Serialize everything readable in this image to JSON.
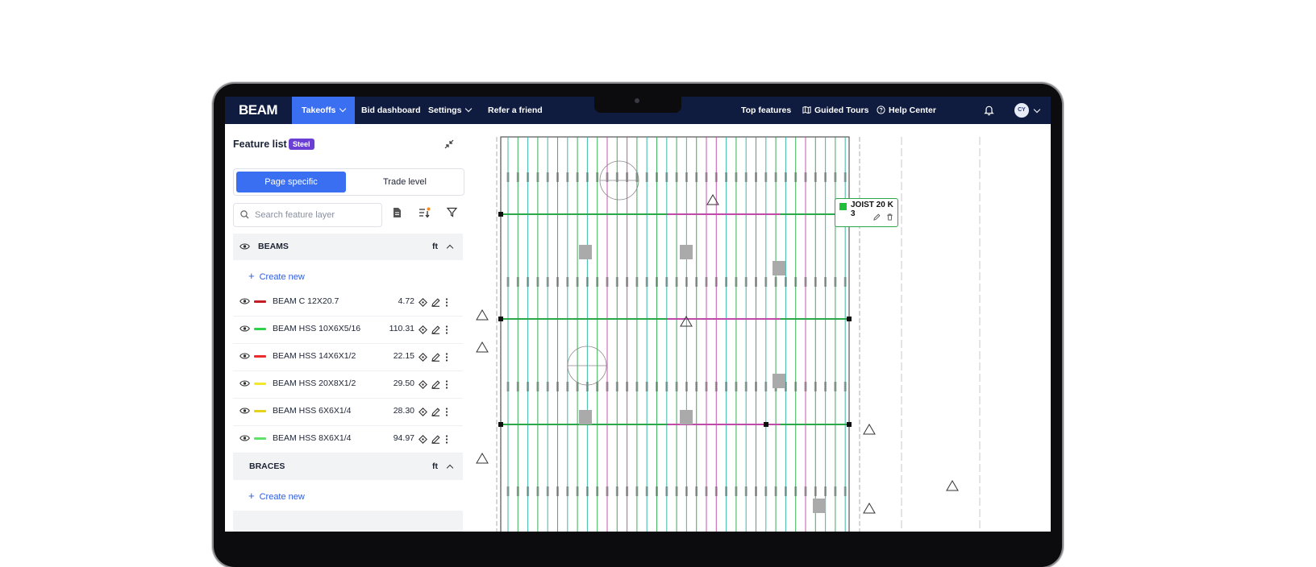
{
  "nav": {
    "logo": "BEAM",
    "items": [
      {
        "label": "Takeoffs",
        "active": true,
        "has_dropdown": true
      },
      {
        "label": "Bid dashboard",
        "active": false,
        "has_dropdown": false
      },
      {
        "label": "Settings",
        "active": false,
        "has_dropdown": true
      },
      {
        "label": "Refer a friend",
        "active": false,
        "has_dropdown": false
      }
    ],
    "right_items": [
      {
        "label": "Top features",
        "icon": ""
      },
      {
        "label": "Guided Tours",
        "icon": "map-icon"
      },
      {
        "label": "Help Center",
        "icon": "help-circle-icon"
      }
    ],
    "avatar_initials": "CY",
    "colors": {
      "background": "#0f1c3f",
      "active": "#3b6ff2"
    }
  },
  "feature_list": {
    "title": "Feature list",
    "badge": "Steel",
    "tabs": {
      "page_specific": "Page specific",
      "trade_level": "Trade level",
      "selected": "page_specific"
    },
    "search_placeholder": "Search feature layer",
    "groups": [
      {
        "name": "BEAMS",
        "unit": "ft",
        "expanded": true,
        "create_label": "Create new",
        "items": [
          {
            "name": "BEAM C 12X20.7",
            "value": "4.72",
            "color": "#c41e25"
          },
          {
            "name": "BEAM HSS 10X6X5/16",
            "value": "110.31",
            "color": "#2dd24a"
          },
          {
            "name": "BEAM HSS 14X6X1/2",
            "value": "22.15",
            "color": "#ee2b2b"
          },
          {
            "name": "BEAM HSS 20X8X1/2",
            "value": "29.50",
            "color": "#f2e72a"
          },
          {
            "name": "BEAM HSS 6X6X1/4",
            "value": "28.30",
            "color": "#e6d21a"
          },
          {
            "name": "BEAM HSS 8X6X1/4",
            "value": "94.97",
            "color": "#5ee26a"
          }
        ]
      },
      {
        "name": "BRACES",
        "unit": "ft",
        "expanded": true,
        "create_label": "Create new",
        "items": []
      }
    ]
  },
  "drawing": {
    "tag": {
      "label": "JOIST 20 K 3",
      "color": "#1fbf3a"
    },
    "colors": {
      "teal": "#2bb3a3",
      "magenta": "#c04aa8",
      "green": "#2aa84a"
    }
  }
}
